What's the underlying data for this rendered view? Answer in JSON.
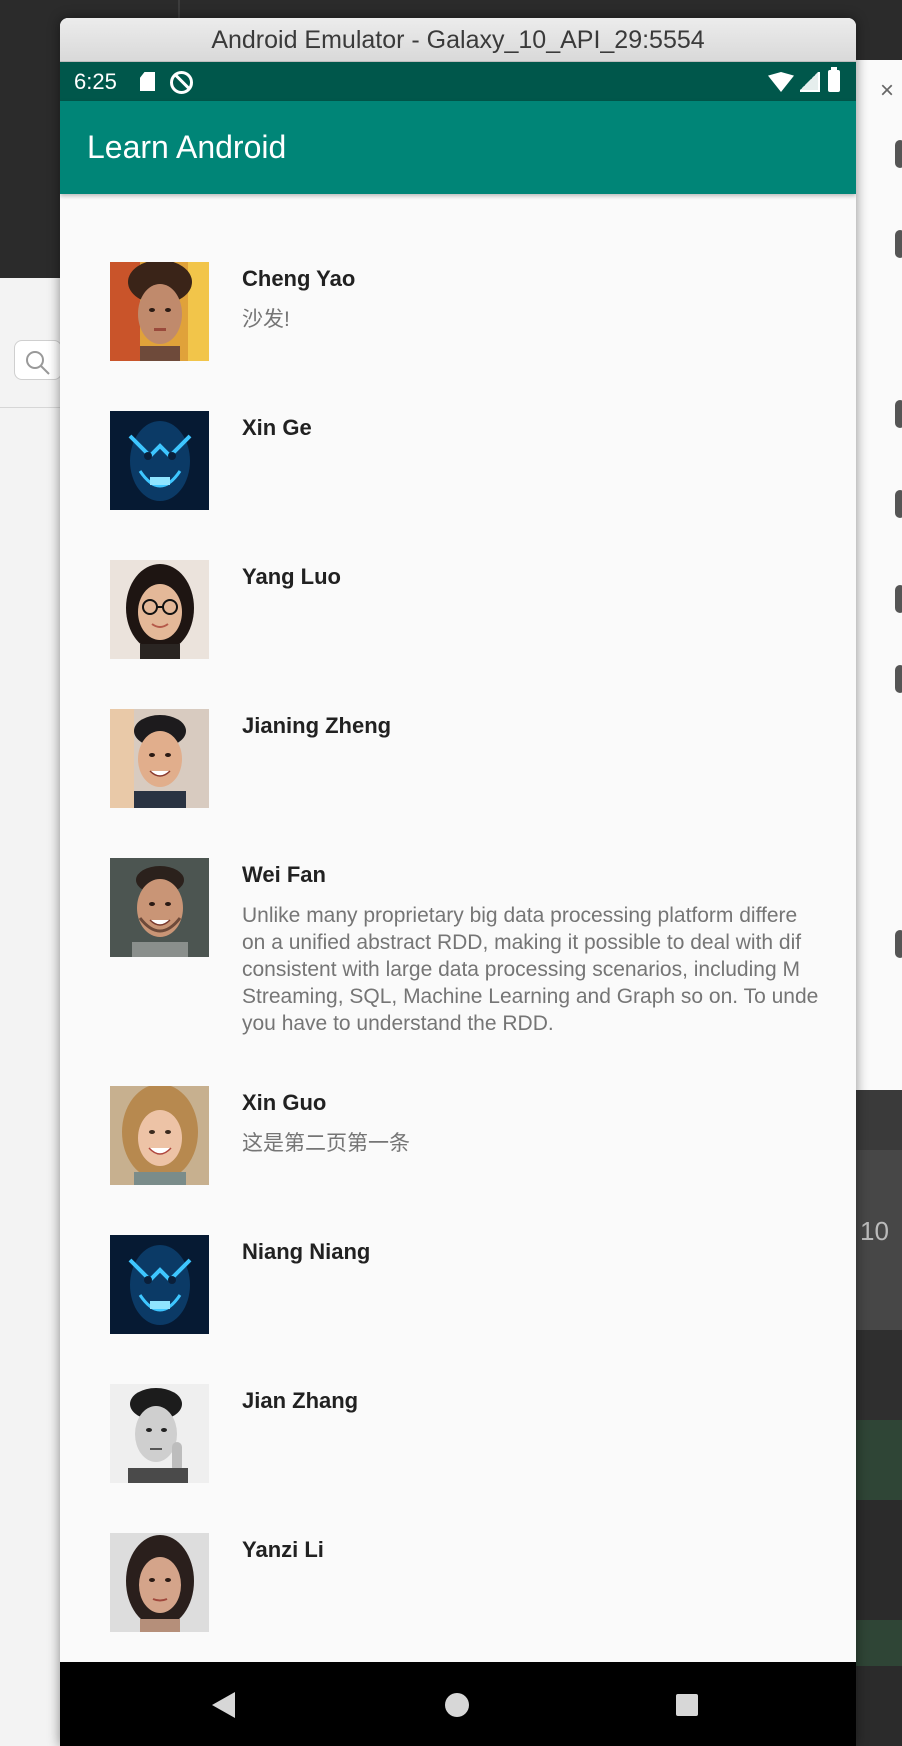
{
  "window": {
    "title": "Android Emulator - Galaxy_10_API_29:5554"
  },
  "status_bar": {
    "time": "6:25"
  },
  "app_bar": {
    "title": "Learn Android"
  },
  "contacts": [
    {
      "name": "Cheng Yao",
      "message": "沙发!",
      "avatar": "portrait-woman-colorful"
    },
    {
      "name": "Xin Ge",
      "message": "",
      "avatar": "masked-figure-blue"
    },
    {
      "name": "Yang Luo",
      "message": "",
      "avatar": "portrait-woman-glasses"
    },
    {
      "name": "Jianing Zheng",
      "message": "",
      "avatar": "portrait-man-smiling"
    },
    {
      "name": "Wei Fan",
      "message_lines": [
        "Unlike many proprietary big data processing platform differe",
        "on a unified abstract RDD, making it possible to deal with dif",
        "consistent with large data processing scenarios, including M",
        "Streaming, SQL, Machine Learning and Graph so on. To unde",
        "you have to understand the RDD."
      ],
      "avatar": "portrait-man-beard"
    },
    {
      "name": "Xin Guo",
      "message": "这是第二页第一条",
      "avatar": "portrait-woman-blonde"
    },
    {
      "name": "Niang Niang",
      "message": "",
      "avatar": "masked-figure-blue"
    },
    {
      "name": "Jian Zhang",
      "message": "",
      "avatar": "portrait-man-bw"
    },
    {
      "name": "Yanzi Li",
      "message": "",
      "avatar": "portrait-woman-dark-hair"
    }
  ],
  "background": {
    "right_panel_text": "10"
  },
  "colors": {
    "primary": "#008577",
    "primary_dark": "#00574b",
    "list_background": "#fafafa"
  }
}
